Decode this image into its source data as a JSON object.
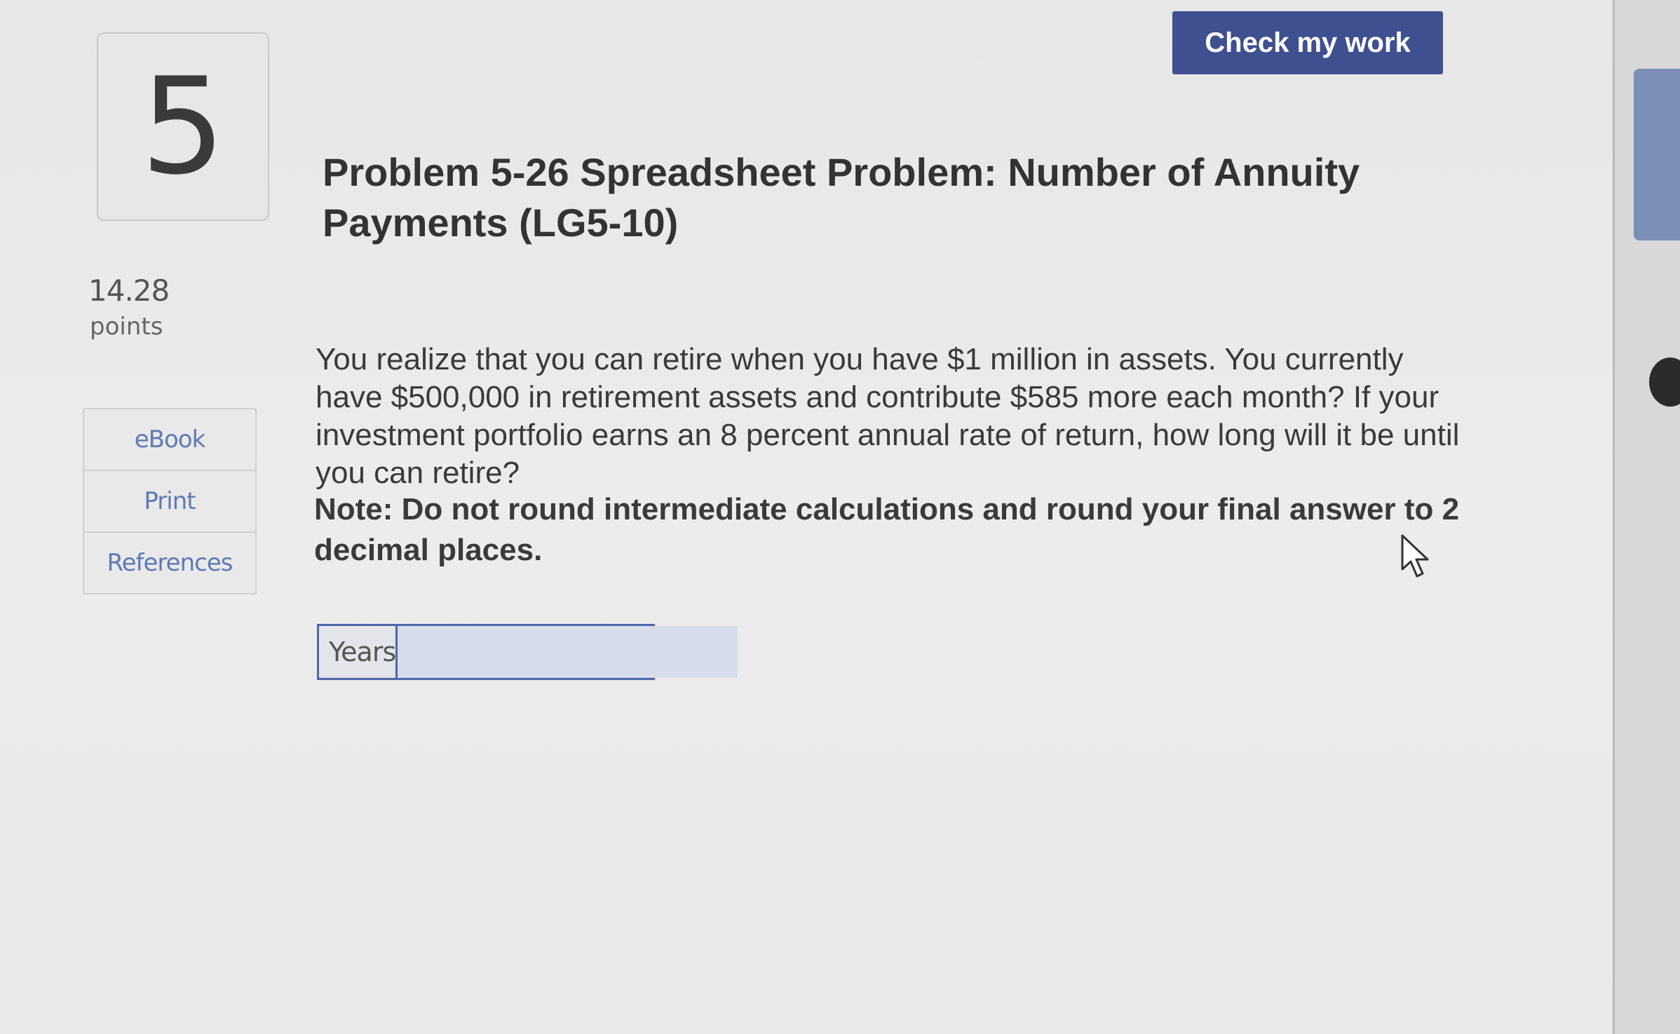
{
  "header": {
    "check_button_label": "Check my work"
  },
  "question": {
    "number": "5",
    "points_value": "14.28",
    "points_label": "points",
    "title": "Problem 5-26 Spreadsheet Problem: Number of Annuity Payments (LG5-10)",
    "body": "You realize that you can retire when you have $1 million in assets. You currently have $500,000 in retirement assets and contribute $585 more each month? If your investment portfolio earns an 8 percent annual rate of return, how long will it be until you can retire?",
    "note": "Note: Do not round intermediate calculations and round your final answer to 2 decimal places."
  },
  "resources": {
    "items": [
      {
        "label": "eBook"
      },
      {
        "label": "Print"
      },
      {
        "label": "References"
      }
    ]
  },
  "answer": {
    "label": "Years",
    "value": ""
  },
  "colors": {
    "button_bg": "#3f4f8f",
    "link": "#5e7ab4",
    "input_border": "#4d67a8"
  }
}
